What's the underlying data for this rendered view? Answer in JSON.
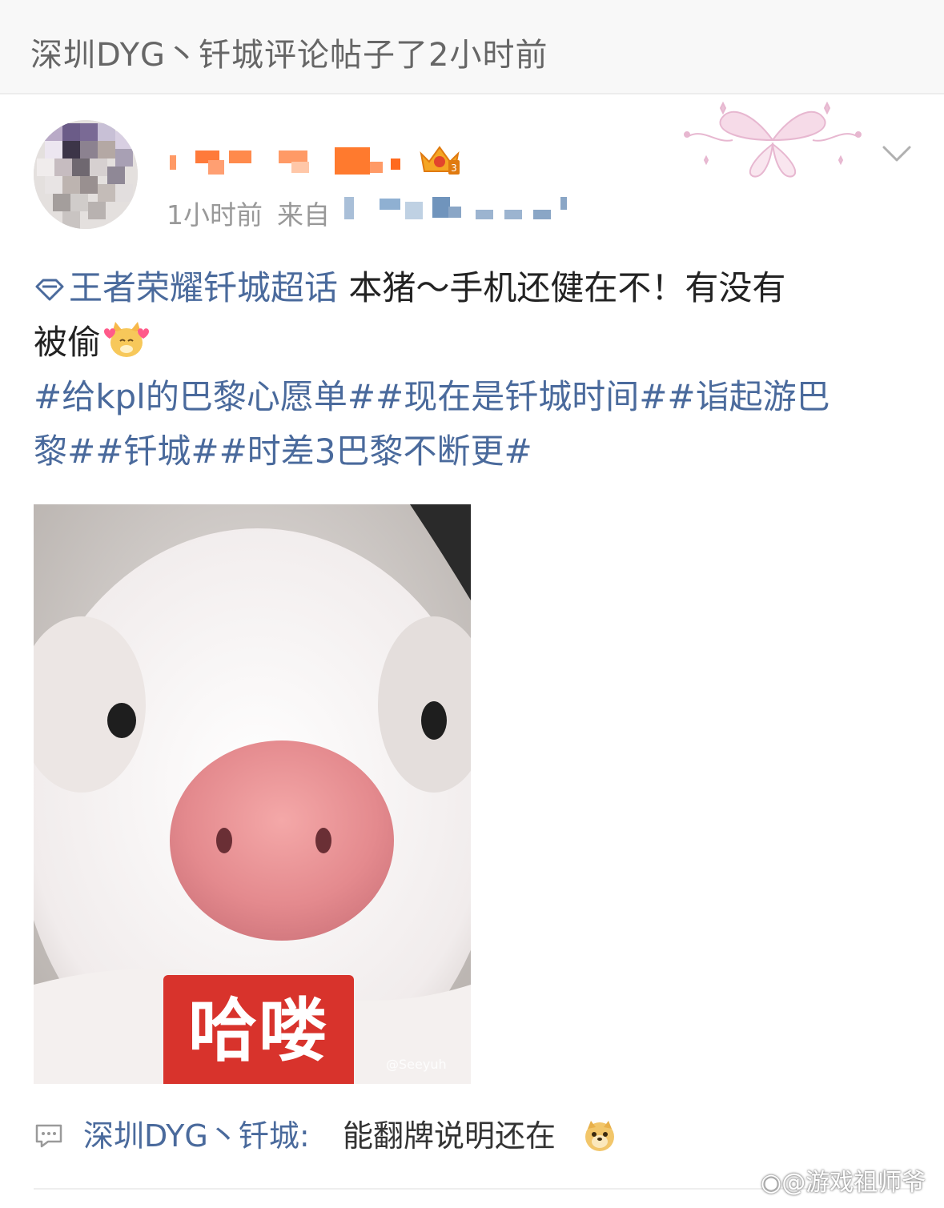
{
  "header": {
    "title": "深圳DYG丶钎城评论帖子了2小时前"
  },
  "post": {
    "time": "1小时前",
    "source_prefix": "来自",
    "topic_link": "王者荣耀钎城超话",
    "text_line1": " 本猪～手机还健在不！有没有",
    "text_line2": "被偷",
    "hashtags_line1": "#给kpl的巴黎心愿单##现在是钎城时间##诣起游巴",
    "hashtags_line2": "黎##钎城##时差3巴黎不断更#",
    "image_caption": "哈喽",
    "image_credit": "@Seeyuh"
  },
  "comment": {
    "author": "深圳DYG丶钎城:",
    "text": " 能翻牌说明还在"
  },
  "watermark": "@游戏祖师爷",
  "colors": {
    "link": "#4a6a9c",
    "caption_bg": "#d8332c",
    "meta": "#999999"
  },
  "icons": [
    "diamond-topic-icon",
    "crown-badge-icon",
    "chevron-down-icon",
    "comment-icon",
    "weibo-logo-icon"
  ]
}
